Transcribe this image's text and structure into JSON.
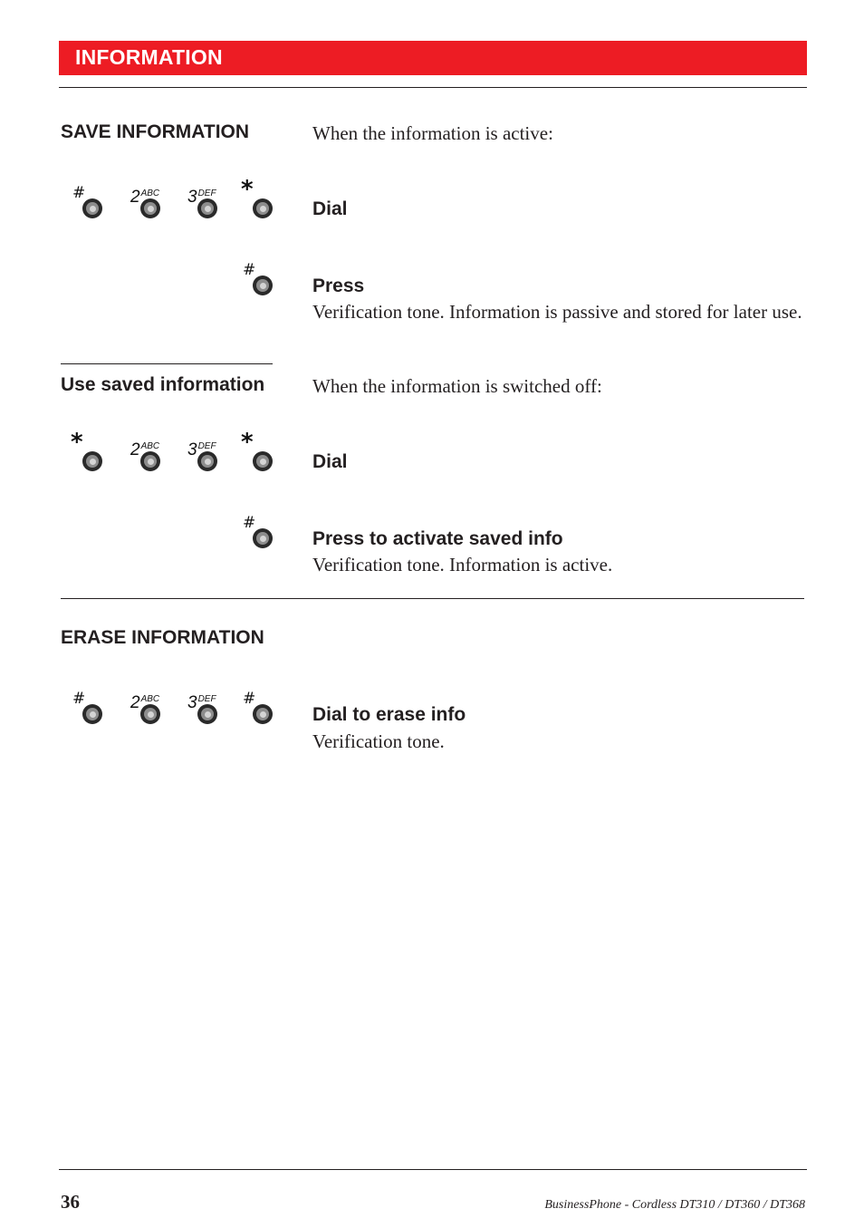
{
  "header": {
    "title": "INFORMATION",
    "banner_color": "#ed1c24"
  },
  "sections": [
    {
      "heading": "SAVE INFORMATION",
      "intro": "When the information is active:",
      "steps": [
        {
          "keys": [
            {
              "icon": "hash-key-icon",
              "symbol": "#",
              "letters": ""
            },
            {
              "icon": "key-2-icon",
              "symbol": "2",
              "letters": "ABC"
            },
            {
              "icon": "key-3-icon",
              "symbol": "3",
              "letters": "DEF"
            },
            {
              "icon": "star-key-icon",
              "symbol": "*",
              "letters": ""
            }
          ],
          "action": "Dial",
          "description": ""
        },
        {
          "keys": [
            {
              "icon": "hash-key-icon",
              "symbol": "#",
              "letters": ""
            }
          ],
          "action": "Press",
          "description": "Verification tone. Information is passive and stored for later use."
        }
      ]
    },
    {
      "heading": "Use saved information",
      "intro": "When the information is switched off:",
      "steps": [
        {
          "keys": [
            {
              "icon": "star-key-icon",
              "symbol": "*",
              "letters": ""
            },
            {
              "icon": "key-2-icon",
              "symbol": "2",
              "letters": "ABC"
            },
            {
              "icon": "key-3-icon",
              "symbol": "3",
              "letters": "DEF"
            },
            {
              "icon": "star-key-icon",
              "symbol": "*",
              "letters": ""
            }
          ],
          "action": "Dial",
          "description": ""
        },
        {
          "keys": [
            {
              "icon": "hash-key-icon",
              "symbol": "#",
              "letters": ""
            }
          ],
          "action": "Press to activate saved info",
          "description": "Verification tone. Information is active."
        }
      ]
    },
    {
      "heading": "ERASE INFORMATION",
      "intro": "",
      "steps": [
        {
          "keys": [
            {
              "icon": "hash-key-icon",
              "symbol": "#",
              "letters": ""
            },
            {
              "icon": "key-2-icon",
              "symbol": "2",
              "letters": "ABC"
            },
            {
              "icon": "key-3-icon",
              "symbol": "3",
              "letters": "DEF"
            },
            {
              "icon": "hash-key-icon",
              "symbol": "#",
              "letters": ""
            }
          ],
          "action": "Dial to erase info",
          "description": "Verification tone."
        }
      ]
    }
  ],
  "footer": {
    "page_number": "36",
    "document_title": "BusinessPhone - Cordless DT310 / DT360 / DT368"
  }
}
